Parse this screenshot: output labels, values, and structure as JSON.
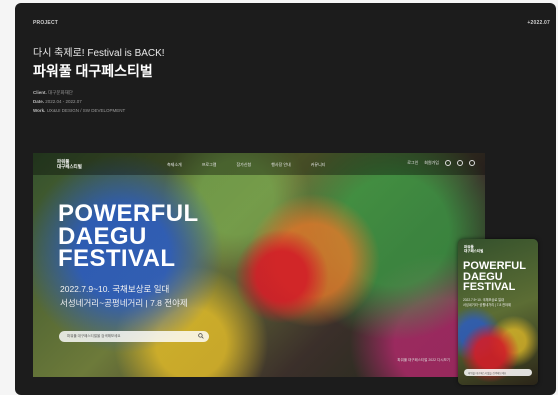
{
  "header": {
    "project_label": "PROJECT",
    "year_label": "+2022.07",
    "subtitle": "다시 축제로! Festival is BACK!",
    "title": "파워풀 대구페스티벌",
    "meta": [
      {
        "key": "Client.",
        "value": "대구문화재단"
      },
      {
        "key": "Date.",
        "value": "2022.04 - 2022.07"
      },
      {
        "key": "Work.",
        "value": "UX&UI DESIGN / SW DEVELOPMENT"
      }
    ]
  },
  "desktop": {
    "logo_line1": "파워풀",
    "logo_line2": "대구페스티벌",
    "nav": [
      "축제소개",
      "프로그램",
      "참가신청",
      "행사장 안내",
      "커뮤니티"
    ],
    "util": "로그인",
    "util2": "회원가입",
    "hero": [
      "POWERFUL",
      "DAEGU",
      "FESTIVAL"
    ],
    "date": "2022.7.9~10. 국채보상로 일대",
    "place": "서성네거리~공평네거리  |  7.8 전야제",
    "search_placeholder": "파워풀 대구페스티벌을 검색해보세요",
    "bottom_right": "파워풀 대구페스티벌 2022 다시보기"
  },
  "mobile": {
    "logo_line1": "파워풀",
    "logo_line2": "대구페스티벌",
    "hero": [
      "POWERFUL",
      "DAEGU",
      "FESTIVAL"
    ],
    "date": "2022.7.9~10. 국채보상로 일대",
    "place": "서성네거리~공평네거리 | 7.8 전야제",
    "search_placeholder": "파워풀 대구페스티벌을 검색해보세요"
  }
}
